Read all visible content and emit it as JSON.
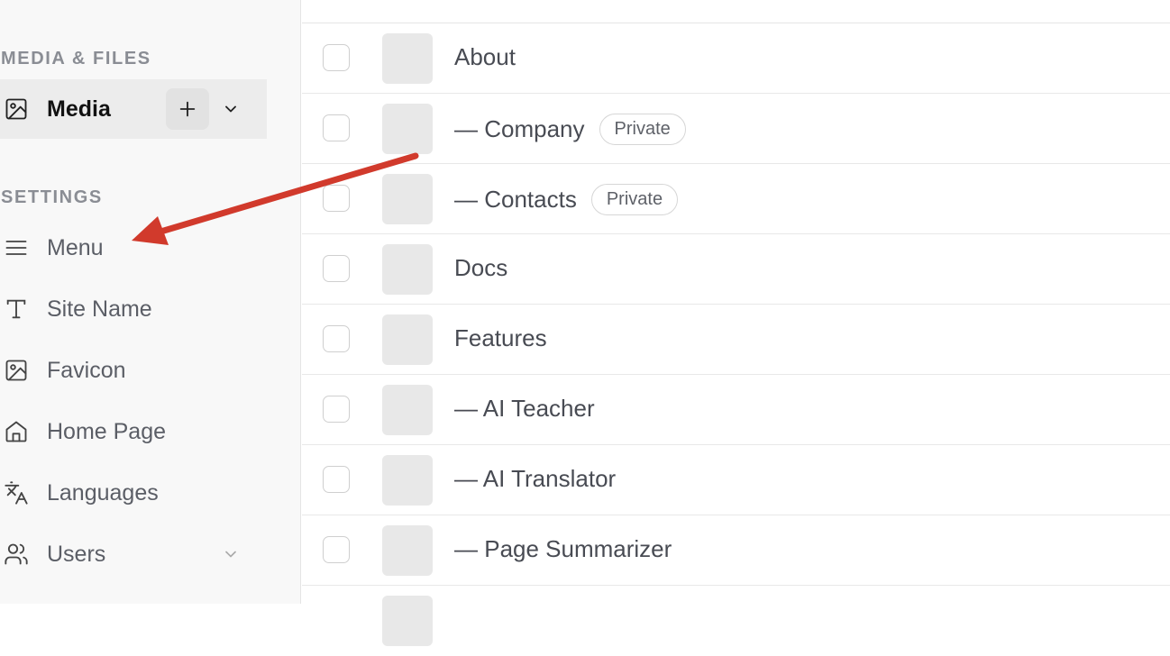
{
  "sidebar": {
    "media_heading": "MEDIA & FILES",
    "media_item": {
      "label": "Media",
      "icon": "image-icon"
    },
    "settings_heading": "SETTINGS",
    "settings_items": [
      {
        "label": "Menu",
        "icon": "menu-icon"
      },
      {
        "label": "Site Name",
        "icon": "text-icon"
      },
      {
        "label": "Favicon",
        "icon": "image-icon"
      },
      {
        "label": "Home Page",
        "icon": "home-icon"
      },
      {
        "label": "Languages",
        "icon": "translate-icon"
      },
      {
        "label": "Users",
        "icon": "users-icon"
      }
    ]
  },
  "pages": [
    {
      "title": "About",
      "badge": ""
    },
    {
      "title": "— Company",
      "badge": "Private"
    },
    {
      "title": "— Contacts",
      "badge": "Private"
    },
    {
      "title": "Docs",
      "badge": ""
    },
    {
      "title": "Features",
      "badge": ""
    },
    {
      "title": "— AI Teacher",
      "badge": ""
    },
    {
      "title": "— AI Translator",
      "badge": ""
    },
    {
      "title": "— Page Summarizer",
      "badge": ""
    }
  ],
  "annotation": {
    "arrow_color": "#d13a2c"
  }
}
